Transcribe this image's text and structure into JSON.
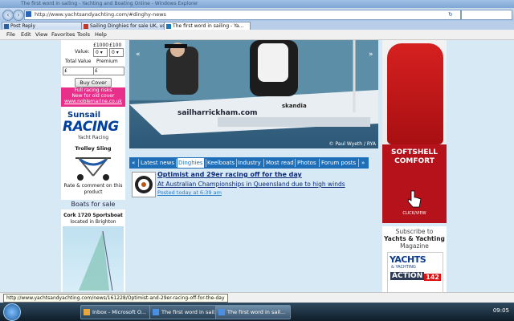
{
  "window": {
    "title": "The first word in sailing - Yachting and Boating Online - Windows Explorer"
  },
  "address": {
    "url": "http://www.yachtsandyachting.com/#dinghy-news"
  },
  "tabs": [
    {
      "label": "Post Reply"
    },
    {
      "label": "Sailing Dinghies for sale UK, us..."
    },
    {
      "label": "The first word in sailing - Ya..."
    }
  ],
  "menu": [
    "File",
    "Edit",
    "View",
    "Favorites",
    "Tools",
    "Help"
  ],
  "insurance": {
    "value_label": "Value:",
    "col1": "£1000",
    "col2": "£100",
    "sel1": "0",
    "sel2": "0",
    "total_label": "Total Value",
    "premium_label": "Premium",
    "total_value": "£",
    "premium_value": "£",
    "button": "Buy Cover"
  },
  "promo": {
    "line1": "Full racing risks",
    "line2": "New for old cover",
    "link": "www.noblemarine.co.uk"
  },
  "sunsail": {
    "brand1": "Sunsail",
    "brand2": "RACING",
    "caption": "Yacht Racing"
  },
  "trolley": {
    "title": "Trolley Sling",
    "caption_line1": "Rate & comment on this",
    "caption_line2": "product"
  },
  "boats_for_sale": {
    "heading": "Boats for sale",
    "item": "Cork 1720 Sportsboat",
    "location": "located in Brighton"
  },
  "hero": {
    "credit": "© Paul Wyeth / RYA",
    "hull_text1": "sailharrickham.com",
    "hull_text2": "skandia"
  },
  "news_nav": {
    "prev": "«",
    "items": [
      "Latest news",
      "Dinghies",
      "Keelboats",
      "Industry",
      "Most read",
      "Photos",
      "Forum posts"
    ],
    "active": "Dinghies",
    "next": "»"
  },
  "article": {
    "title": "Optimist and 29er racing off for the day",
    "subtitle": "At Australian Championships in Queensland due to high winds",
    "posted": "Posted today at 6:39 am"
  },
  "right_ad": {
    "line1": "SOFTSHELL",
    "line2": "COMFORT",
    "cta": "CLICK/VIEW"
  },
  "subscribe": {
    "line1": "Subscribe to",
    "line2": "Yachts & Yachting",
    "line3": "Magazine",
    "mag_title": "YACHTS",
    "mag_sub": "& YACHTING",
    "mag_action": "ACTION",
    "mag_num": "142"
  },
  "status": {
    "tooltip": "http://www.yachtsandyachting.com/news/161228/Optimist-and-29er-racing-off-for-the-day"
  },
  "taskbar": {
    "tasks": [
      "Inbox - Microsoft O...",
      "The first word in sail...",
      "The first word in sail..."
    ],
    "clock": "09:05"
  }
}
